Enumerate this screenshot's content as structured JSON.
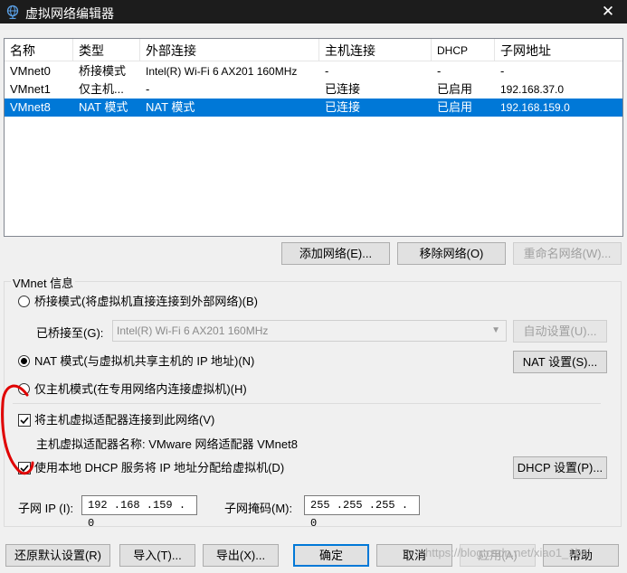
{
  "window": {
    "title": "虚拟网络编辑器",
    "close_glyph": "✕"
  },
  "list": {
    "columns": [
      "名称",
      "类型",
      "外部连接",
      "主机连接",
      "DHCP",
      "子网地址"
    ],
    "rows": [
      {
        "name": "VMnet0",
        "type": "桥接模式",
        "external": "Intel(R) Wi-Fi 6 AX201 160MHz",
        "host": "-",
        "dhcp": "-",
        "subnet": "-",
        "selected": false
      },
      {
        "name": "VMnet1",
        "type": "仅主机...",
        "external": "-",
        "host": "已连接",
        "dhcp": "已启用",
        "subnet": "192.168.37.0",
        "selected": false
      },
      {
        "name": "VMnet8",
        "type": "NAT 模式",
        "external": "NAT 模式",
        "host": "已连接",
        "dhcp": "已启用",
        "subnet": "192.168.159.0",
        "selected": true
      }
    ]
  },
  "list_buttons": {
    "add": "添加网络(E)...",
    "remove": "移除网络(O)",
    "rename": "重命名网络(W)..."
  },
  "vmnet_info": {
    "title": "VMnet 信息",
    "bridged_label": "桥接模式(将虚拟机直接连接到外部网络)(B)",
    "bridged_to_label": "已桥接至(G):",
    "bridged_to_value": "Intel(R) Wi-Fi 6 AX201 160MHz",
    "auto_settings": "自动设置(U)...",
    "nat_label": "NAT 模式(与虚拟机共享主机的 IP 地址)(N)",
    "nat_settings": "NAT 设置(S)...",
    "hostonly_label": "仅主机模式(在专用网络内连接虚拟机)(H)",
    "connect_adapter_label": "将主机虚拟适配器连接到此网络(V)",
    "adapter_name_label": "主机虚拟适配器名称: VMware 网络适配器 VMnet8",
    "dhcp_label": "使用本地 DHCP 服务将 IP 地址分配给虚拟机(D)",
    "dhcp_settings": "DHCP 设置(P)...",
    "subnet_ip_label": "子网 IP (I):",
    "subnet_ip_value": "192 .168 .159 . 0",
    "subnet_mask_label": "子网掩码(M):",
    "subnet_mask_value": "255 .255 .255 . 0",
    "selected_mode": "nat",
    "connect_adapter_checked": true,
    "dhcp_checked": true
  },
  "footer": {
    "restore": "还原默认设置(R)",
    "import": "导入(T)...",
    "export": "导出(X)...",
    "ok": "确定",
    "cancel": "取消",
    "apply": "应用(A)",
    "help": "帮助"
  },
  "watermark": "https://blog.csdn.net/xiao1_1bai",
  "colors": {
    "titlebar": "#1c1c1c",
    "selection": "#0078d7",
    "annotation": "#e00000"
  }
}
